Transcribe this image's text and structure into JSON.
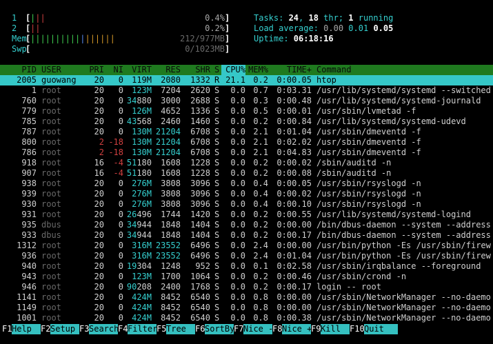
{
  "meters": {
    "cpu1": {
      "label": "1",
      "percent": "0.4%",
      "bar_fraction": 0.004
    },
    "cpu2": {
      "label": "2",
      "percent": "0.2%",
      "bar_fraction": 0.002
    },
    "mem": {
      "label": "Mem",
      "value": "212/977MB",
      "bar_fraction": 0.217
    },
    "swp": {
      "label": "Swp",
      "value": "0/1023MB",
      "bar_fraction": 0.0
    }
  },
  "stats": {
    "tasks_label": "Tasks: ",
    "tasks": "24",
    "sep1": ", ",
    "threads": "18",
    "thr_label": " thr; ",
    "running": "1",
    "running_label": " running",
    "load_label": "Load average: ",
    "load1": "0.00",
    "load5": "0.01",
    "load15": "0.05",
    "uptime_label": "Uptime: ",
    "uptime": "06:18:16"
  },
  "columns": [
    "PID",
    "USER",
    "PRI",
    "NI",
    "VIRT",
    "RES",
    "SHR",
    "S",
    "CPU%",
    "MEM%",
    "TIME+",
    "Command"
  ],
  "sorted_column": "CPU%",
  "processes": [
    {
      "pid": "2005",
      "user": "guowang",
      "pri": "20",
      "ni": "0",
      "virt": "119M",
      "res": "2080",
      "shr": "1332",
      "s": "R",
      "cpu": "21.1",
      "mem": "0.2",
      "time": "0:00.05",
      "cmd": "htop"
    },
    {
      "pid": "1",
      "user": "root",
      "pri": "20",
      "ni": "0",
      "virt": "123M",
      "res": "7204",
      "shr": "2620",
      "s": "S",
      "cpu": "0.0",
      "mem": "0.7",
      "time": "0:03.31",
      "cmd": "/usr/lib/systemd/systemd --switched"
    },
    {
      "pid": "760",
      "user": "root",
      "pri": "20",
      "ni": "0",
      "virt": "34880",
      "res": "3000",
      "shr": "2688",
      "s": "S",
      "cpu": "0.0",
      "mem": "0.3",
      "time": "0:00.48",
      "cmd": "/usr/lib/systemd/systemd-journald"
    },
    {
      "pid": "779",
      "user": "root",
      "pri": "20",
      "ni": "0",
      "virt": "126M",
      "res": "4652",
      "shr": "1336",
      "s": "S",
      "cpu": "0.0",
      "mem": "0.5",
      "time": "0:00.01",
      "cmd": "/usr/sbin/lvmetad -f"
    },
    {
      "pid": "785",
      "user": "root",
      "pri": "20",
      "ni": "0",
      "virt": "43568",
      "res": "2460",
      "shr": "1460",
      "s": "S",
      "cpu": "0.0",
      "mem": "0.2",
      "time": "0:00.84",
      "cmd": "/usr/lib/systemd/systemd-udevd"
    },
    {
      "pid": "787",
      "user": "root",
      "pri": "20",
      "ni": "0",
      "virt": "130M",
      "res": "21204",
      "shr": "6708",
      "s": "S",
      "cpu": "0.0",
      "mem": "2.1",
      "time": "0:01.04",
      "cmd": "/usr/sbin/dmeventd -f"
    },
    {
      "pid": "800",
      "user": "root",
      "pri": "2",
      "ni": "-18",
      "virt": "130M",
      "res": "21204",
      "shr": "6708",
      "s": "S",
      "cpu": "0.0",
      "mem": "2.1",
      "time": "0:02.02",
      "cmd": "/usr/sbin/dmeventd -f"
    },
    {
      "pid": "786",
      "user": "root",
      "pri": "2",
      "ni": "-18",
      "virt": "130M",
      "res": "21204",
      "shr": "6708",
      "s": "S",
      "cpu": "0.0",
      "mem": "2.1",
      "time": "0:04.83",
      "cmd": "/usr/sbin/dmeventd -f"
    },
    {
      "pid": "918",
      "user": "root",
      "pri": "16",
      "ni": "-4",
      "virt": "51180",
      "res": "1608",
      "shr": "1228",
      "s": "S",
      "cpu": "0.0",
      "mem": "0.2",
      "time": "0:00.02",
      "cmd": "/sbin/auditd -n"
    },
    {
      "pid": "907",
      "user": "root",
      "pri": "16",
      "ni": "-4",
      "virt": "51180",
      "res": "1608",
      "shr": "1228",
      "s": "S",
      "cpu": "0.0",
      "mem": "0.2",
      "time": "0:00.08",
      "cmd": "/sbin/auditd -n"
    },
    {
      "pid": "938",
      "user": "root",
      "pri": "20",
      "ni": "0",
      "virt": "276M",
      "res": "3808",
      "shr": "3096",
      "s": "S",
      "cpu": "0.0",
      "mem": "0.4",
      "time": "0:00.05",
      "cmd": "/usr/sbin/rsyslogd -n"
    },
    {
      "pid": "939",
      "user": "root",
      "pri": "20",
      "ni": "0",
      "virt": "276M",
      "res": "3808",
      "shr": "3096",
      "s": "S",
      "cpu": "0.0",
      "mem": "0.4",
      "time": "0:00.02",
      "cmd": "/usr/sbin/rsyslogd -n"
    },
    {
      "pid": "930",
      "user": "root",
      "pri": "20",
      "ni": "0",
      "virt": "276M",
      "res": "3808",
      "shr": "3096",
      "s": "S",
      "cpu": "0.0",
      "mem": "0.4",
      "time": "0:00.10",
      "cmd": "/usr/sbin/rsyslogd -n"
    },
    {
      "pid": "931",
      "user": "root",
      "pri": "20",
      "ni": "0",
      "virt": "26496",
      "res": "1744",
      "shr": "1420",
      "s": "S",
      "cpu": "0.0",
      "mem": "0.2",
      "time": "0:00.55",
      "cmd": "/usr/lib/systemd/systemd-logind"
    },
    {
      "pid": "935",
      "user": "dbus",
      "pri": "20",
      "ni": "0",
      "virt": "34944",
      "res": "1848",
      "shr": "1404",
      "s": "S",
      "cpu": "0.0",
      "mem": "0.2",
      "time": "0:00.00",
      "cmd": "/bin/dbus-daemon --system --address"
    },
    {
      "pid": "933",
      "user": "dbus",
      "pri": "20",
      "ni": "0",
      "virt": "34944",
      "res": "1848",
      "shr": "1404",
      "s": "S",
      "cpu": "0.0",
      "mem": "0.2",
      "time": "0:00.17",
      "cmd": "/bin/dbus-daemon --system --address"
    },
    {
      "pid": "1312",
      "user": "root",
      "pri": "20",
      "ni": "0",
      "virt": "316M",
      "res": "23552",
      "shr": "6496",
      "s": "S",
      "cpu": "0.0",
      "mem": "2.4",
      "time": "0:00.00",
      "cmd": "/usr/bin/python -Es /usr/sbin/firew"
    },
    {
      "pid": "936",
      "user": "root",
      "pri": "20",
      "ni": "0",
      "virt": "316M",
      "res": "23552",
      "shr": "6496",
      "s": "S",
      "cpu": "0.0",
      "mem": "2.4",
      "time": "0:01.04",
      "cmd": "/usr/bin/python -Es /usr/sbin/firew"
    },
    {
      "pid": "940",
      "user": "root",
      "pri": "20",
      "ni": "0",
      "virt": "19304",
      "res": "1248",
      "shr": "952",
      "s": "S",
      "cpu": "0.0",
      "mem": "0.1",
      "time": "0:02.58",
      "cmd": "/usr/sbin/irqbalance --foreground"
    },
    {
      "pid": "943",
      "user": "root",
      "pri": "20",
      "ni": "0",
      "virt": "123M",
      "res": "1700",
      "shr": "1064",
      "s": "S",
      "cpu": "0.0",
      "mem": "0.2",
      "time": "0:00.46",
      "cmd": "/usr/sbin/crond -n"
    },
    {
      "pid": "946",
      "user": "root",
      "pri": "20",
      "ni": "0",
      "virt": "90208",
      "res": "2400",
      "shr": "1768",
      "s": "S",
      "cpu": "0.0",
      "mem": "0.2",
      "time": "0:00.17",
      "cmd": "login -- root"
    },
    {
      "pid": "1141",
      "user": "root",
      "pri": "20",
      "ni": "0",
      "virt": "424M",
      "res": "8452",
      "shr": "6540",
      "s": "S",
      "cpu": "0.0",
      "mem": "0.8",
      "time": "0:00.00",
      "cmd": "/usr/sbin/NetworkManager --no-daemo"
    },
    {
      "pid": "1149",
      "user": "root",
      "pri": "20",
      "ni": "0",
      "virt": "424M",
      "res": "8452",
      "shr": "6540",
      "s": "S",
      "cpu": "0.0",
      "mem": "0.8",
      "time": "0:00.00",
      "cmd": "/usr/sbin/NetworkManager --no-daemo"
    },
    {
      "pid": "1001",
      "user": "root",
      "pri": "20",
      "ni": "0",
      "virt": "424M",
      "res": "8452",
      "shr": "6540",
      "s": "S",
      "cpu": "0.0",
      "mem": "0.8",
      "time": "0:00.38",
      "cmd": "/usr/sbin/NetworkManager --no-daemo"
    }
  ],
  "function_keys": [
    {
      "key": "F1",
      "label": "Help"
    },
    {
      "key": "F2",
      "label": "Setup"
    },
    {
      "key": "F3",
      "label": "Search"
    },
    {
      "key": "F4",
      "label": "Filter"
    },
    {
      "key": "F5",
      "label": "Tree"
    },
    {
      "key": "F6",
      "label": "SortBy"
    },
    {
      "key": "F7",
      "label": "Nice -"
    },
    {
      "key": "F8",
      "label": "Nice +"
    },
    {
      "key": "F9",
      "label": "Kill"
    },
    {
      "key": "F10",
      "label": "Quit"
    }
  ],
  "colors": {
    "header_bg": "#1f7a1f",
    "selected_bg": "#35c8c8",
    "accent_cyan": "#35d0d0"
  }
}
